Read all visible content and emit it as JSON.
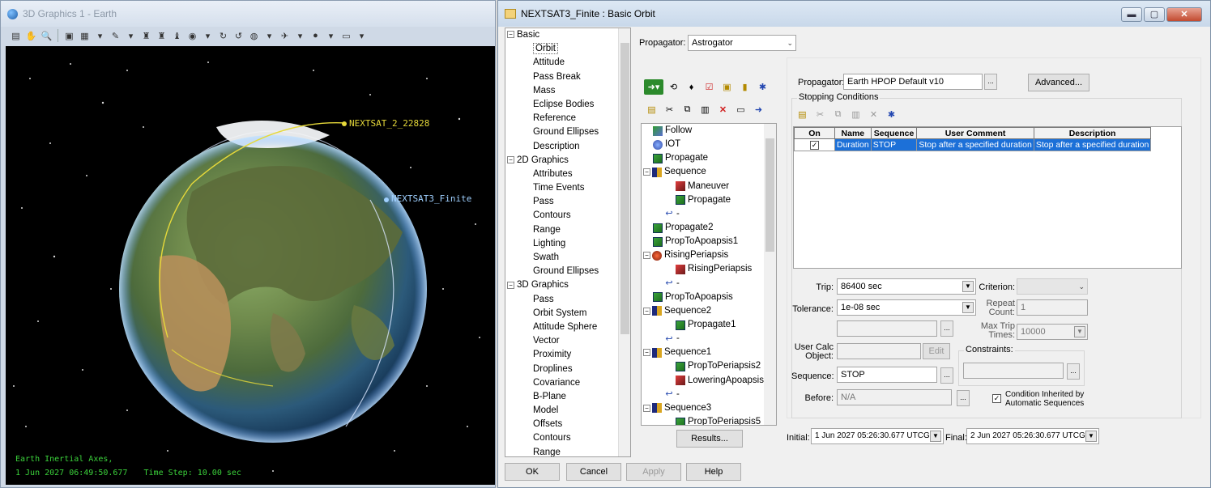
{
  "graphics_window": {
    "title": "3D Graphics 1 - Earth",
    "toolbar_icons": [
      "new-icon",
      "hand-icon",
      "zoom-icon",
      "view-icon",
      "map-icon",
      "dropdown-icon",
      "pin-icon",
      "dropdown-icon",
      "figure-icon",
      "figure2-icon",
      "figure3-icon",
      "camera-icon",
      "dropdown-icon",
      "tool-icon",
      "tool2-icon",
      "globe-icon",
      "dropdown-icon",
      "bird-icon",
      "dropdown-icon",
      "earth-icon",
      "dropdown-icon",
      "screen-icon",
      "dropdown-icon"
    ],
    "labels": {
      "satellite_1": "NEXTSAT_2_22828",
      "satellite_2": "NEXTSAT3_Finite"
    },
    "hud_line1": "Earth Inertial Axes,",
    "hud_line2": "1 Jun 2027 06:49:50.677",
    "hud_time_step": "Time Step: 10.00 sec",
    "colors": {
      "sat1": "#e6d93a",
      "sat2": "#9fd0ff",
      "hud": "#3bd23b"
    }
  },
  "dialog": {
    "title": "NEXTSAT3_Finite : Basic Orbit",
    "window_buttons": [
      "minimize-icon",
      "maximize-icon",
      "close-icon"
    ],
    "tree": [
      {
        "type": "group",
        "label": "Basic"
      },
      {
        "type": "sel",
        "label": "Orbit"
      },
      {
        "type": "leaf",
        "label": "Attitude"
      },
      {
        "type": "leaf",
        "label": "Pass Break"
      },
      {
        "type": "leaf",
        "label": "Mass"
      },
      {
        "type": "leaf",
        "label": "Eclipse Bodies"
      },
      {
        "type": "leaf",
        "label": "Reference"
      },
      {
        "type": "leaf",
        "label": "Ground Ellipses"
      },
      {
        "type": "leaf",
        "label": "Description"
      },
      {
        "type": "group",
        "label": "2D Graphics"
      },
      {
        "type": "leaf",
        "label": "Attributes"
      },
      {
        "type": "leaf",
        "label": "Time Events"
      },
      {
        "type": "leaf",
        "label": "Pass"
      },
      {
        "type": "leaf",
        "label": "Contours"
      },
      {
        "type": "leaf",
        "label": "Range"
      },
      {
        "type": "leaf",
        "label": "Lighting"
      },
      {
        "type": "leaf",
        "label": "Swath"
      },
      {
        "type": "leaf",
        "label": "Ground Ellipses"
      },
      {
        "type": "group",
        "label": "3D Graphics"
      },
      {
        "type": "leaf",
        "label": "Pass"
      },
      {
        "type": "leaf",
        "label": "Orbit System"
      },
      {
        "type": "leaf",
        "label": "Attitude Sphere"
      },
      {
        "type": "leaf",
        "label": "Vector"
      },
      {
        "type": "leaf",
        "label": "Proximity"
      },
      {
        "type": "leaf",
        "label": "Droplines"
      },
      {
        "type": "leaf",
        "label": "Covariance"
      },
      {
        "type": "leaf",
        "label": "B-Plane"
      },
      {
        "type": "leaf",
        "label": "Model"
      },
      {
        "type": "leaf",
        "label": "Offsets"
      },
      {
        "type": "leaf",
        "label": "Contours"
      },
      {
        "type": "leaf",
        "label": "Range"
      }
    ],
    "propagator_label": "Propagator:",
    "propagator_value": "Astrogator",
    "mcs_toolbar_row1": [
      "run-icon",
      "target-icon",
      "tag-icon",
      "check-icon",
      "note-icon",
      "doc-icon",
      "settings-icon"
    ],
    "mcs_toolbar_row2": [
      "new-icon",
      "cut-icon",
      "copy-icon",
      "paste-icon",
      "delete-icon",
      "print-icon",
      "arrow-icon"
    ],
    "mcs": [
      {
        "indent": 0,
        "icon": "follow",
        "label": "Follow"
      },
      {
        "indent": 0,
        "icon": "iot",
        "label": "IOT"
      },
      {
        "indent": 0,
        "icon": "prop",
        "label": "Propagate"
      },
      {
        "indent": 0,
        "icon": "seq",
        "label": "Sequence",
        "box": "⊟"
      },
      {
        "indent": 2,
        "icon": "man",
        "label": "Maneuver"
      },
      {
        "indent": 2,
        "icon": "prop",
        "label": "Propagate"
      },
      {
        "indent": 1,
        "icon": "ret",
        "label": "-"
      },
      {
        "indent": 0,
        "icon": "prop",
        "label": "Propagate2"
      },
      {
        "indent": 0,
        "icon": "prop",
        "label": "PropToApoapsis1"
      },
      {
        "indent": 0,
        "icon": "rise",
        "label": "RisingPeriapsis",
        "box": "⊟"
      },
      {
        "indent": 2,
        "icon": "man",
        "label": "RisingPeriapsis"
      },
      {
        "indent": 1,
        "icon": "ret",
        "label": "-"
      },
      {
        "indent": 0,
        "icon": "prop",
        "label": "PropToApoapsis"
      },
      {
        "indent": 0,
        "icon": "seq",
        "label": "Sequence2",
        "box": "⊟"
      },
      {
        "indent": 2,
        "icon": "prop",
        "label": "Propagate1"
      },
      {
        "indent": 1,
        "icon": "ret",
        "label": "-"
      },
      {
        "indent": 0,
        "icon": "seq",
        "label": "Sequence1",
        "box": "⊟"
      },
      {
        "indent": 2,
        "icon": "prop",
        "label": "PropToPeriapsis2"
      },
      {
        "indent": 2,
        "icon": "man",
        "label": "LoweringApoapsis"
      },
      {
        "indent": 1,
        "icon": "ret",
        "label": "-"
      },
      {
        "indent": 0,
        "icon": "seq",
        "label": "Sequence3",
        "box": "⊟"
      },
      {
        "indent": 2,
        "icon": "prop",
        "label": "PropToPeriapsis5"
      }
    ],
    "results_label": "Results...",
    "segment": {
      "propagator_label": "Propagator:",
      "propagator_value": "Earth HPOP Default v10",
      "advanced_label": "Advanced...",
      "stopping_caption": "Stopping Conditions",
      "stop_toolbar": [
        "new-icon",
        "cut-icon",
        "copy-icon",
        "paste-icon",
        "delete-icon",
        "settings-icon"
      ],
      "columns": [
        "On",
        "Name",
        "Sequence",
        "User Comment",
        "Description"
      ],
      "rows": [
        {
          "on": "✓",
          "name": "Duration",
          "sequence": "STOP",
          "comment": "Stop after a specified duration",
          "description": "Stop after a specified duration"
        }
      ],
      "trip_label": "Trip:",
      "trip_value": "86400 sec",
      "tolerance_label": "Tolerance:",
      "tolerance_value": "1e-08 sec",
      "criterion_label": "Criterion:",
      "repeat_label": "Repeat Count:",
      "repeat_value": "1",
      "max_trip_label": "Max Trip Times:",
      "max_trip_value": "10000",
      "user_calc_label": "User Calc Object:",
      "edit_label": "Edit",
      "constraints_caption": "Constraints:",
      "sequence_label": "Sequence:",
      "sequence_value": "STOP",
      "before_label": "Before:",
      "before_value": "N/A",
      "inherited_label": "Condition Inherited by Automatic Sequences",
      "browse_label": "..."
    },
    "initial_label": "Initial:",
    "initial_value": "1 Jun 2027 05:26:30.677 UTCG",
    "final_label": "Final:",
    "final_value": "2 Jun 2027 05:26:30.677 UTCG",
    "buttons": {
      "ok": "OK",
      "cancel": "Cancel",
      "apply": "Apply",
      "help": "Help"
    }
  }
}
